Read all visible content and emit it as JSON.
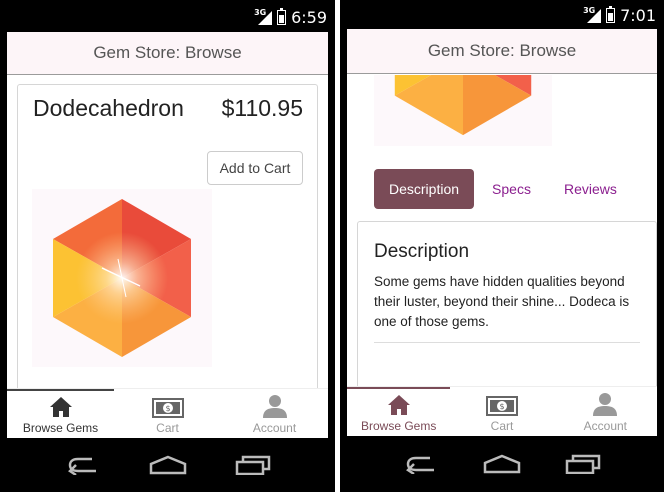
{
  "screens": [
    {
      "status": {
        "network": "3G",
        "time": "6:59"
      },
      "app_title": "Gem Store: Browse",
      "gem": {
        "name": "Dodecahedron",
        "price": "$110.95",
        "add_to_cart": "Add to Cart"
      },
      "bottom_nav": [
        {
          "label": "Browse Gems",
          "icon": "home-icon",
          "active": true
        },
        {
          "label": "Cart",
          "icon": "money-icon",
          "active": false
        },
        {
          "label": "Account",
          "icon": "person-icon",
          "active": false
        }
      ]
    },
    {
      "status": {
        "network": "3G",
        "time": "7:01"
      },
      "app_title": "Gem Store: Browse",
      "tabs": [
        {
          "label": "Description",
          "active": true
        },
        {
          "label": "Specs",
          "active": false
        },
        {
          "label": "Reviews",
          "active": false
        }
      ],
      "description": {
        "heading": "Description",
        "body": "Some gems have hidden qualities beyond their luster, beyond their shine... Dodeca is one of those gems."
      },
      "bottom_nav": [
        {
          "label": "Browse Gems",
          "icon": "home-icon",
          "active": true
        },
        {
          "label": "Cart",
          "icon": "money-icon",
          "active": false
        },
        {
          "label": "Account",
          "icon": "person-icon",
          "active": false
        }
      ]
    }
  ],
  "colors": {
    "appbar_bg": "#fdf5f8",
    "tab_active_bg": "#7a4b57",
    "tab_link": "#8b1f8f",
    "gem_top": "#ee5a3b",
    "gem_left": "#fbbd2d",
    "gem_bottom": "#f7a03c"
  }
}
